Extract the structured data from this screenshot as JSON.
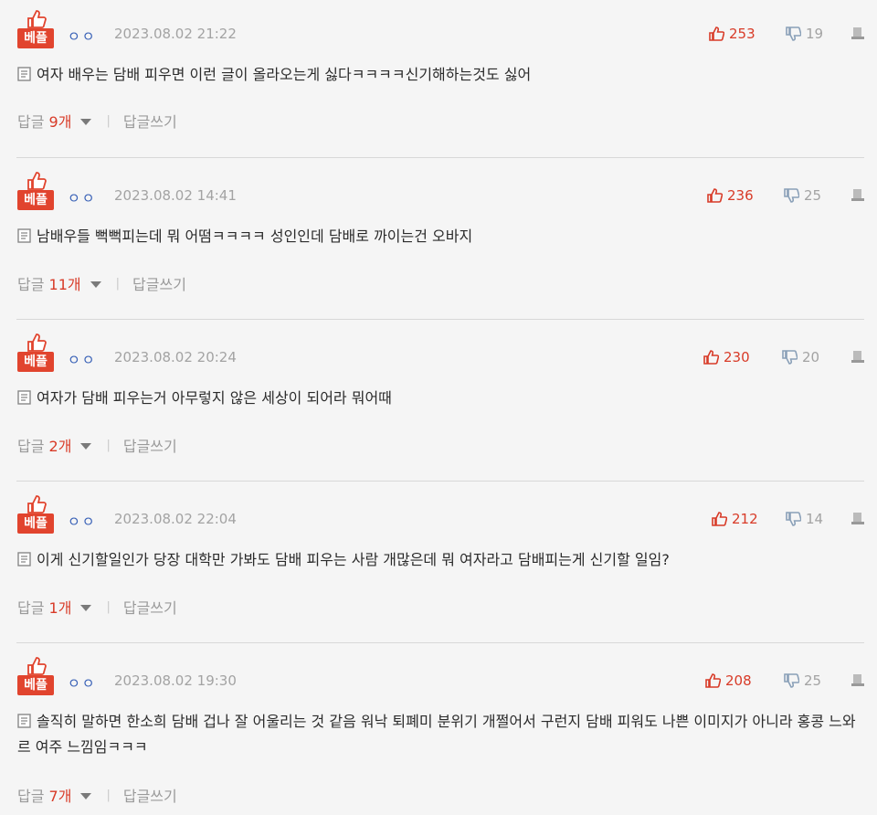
{
  "badge_label": "베플",
  "icons": {
    "best": "thumbs-up-icon",
    "upvote": "thumbs-up-icon",
    "downvote": "thumbs-down-icon",
    "report": "report-icon",
    "text": "document-icon"
  },
  "colors": {
    "accent": "#e1442e",
    "upvote": "#d83b28",
    "nickname": "#3a62b7",
    "muted": "#a3a3a3"
  },
  "comments": [
    {
      "nickname": "ㅇㅇ",
      "date": "2023.08.02 21:22",
      "up": "253",
      "down": "19",
      "text": "여자 배우는 담배 피우면 이런 글이 올라오는게 싫다ㅋㅋㅋㅋ신기해하는것도 싫어",
      "reply_label": "답글",
      "reply_count": "9개",
      "write_reply": "답글쓰기"
    },
    {
      "nickname": "ㅇㅇ",
      "date": "2023.08.02 14:41",
      "up": "236",
      "down": "25",
      "text": "남배우들 뻑뻑피는데 뭐 어떰ㅋㅋㅋㅋ 성인인데 담배로 까이는건 오바지",
      "reply_label": "답글",
      "reply_count": "11개",
      "write_reply": "답글쓰기"
    },
    {
      "nickname": "ㅇㅇ",
      "date": "2023.08.02 20:24",
      "up": "230",
      "down": "20",
      "text": "여자가 담배 피우는거 아무렇지 않은 세상이 되어라 뭐어때",
      "reply_label": "답글",
      "reply_count": "2개",
      "write_reply": "답글쓰기"
    },
    {
      "nickname": "ㅇㅇ",
      "date": "2023.08.02 22:04",
      "up": "212",
      "down": "14",
      "text": "이게 신기할일인가 당장 대학만 가봐도 담배 피우는 사람 개많은데 뭐 여자라고 담배피는게 신기할 일임?",
      "reply_label": "답글",
      "reply_count": "1개",
      "write_reply": "답글쓰기"
    },
    {
      "nickname": "ㅇㅇ",
      "date": "2023.08.02 19:30",
      "up": "208",
      "down": "25",
      "text": "솔직히 말하면 한소희 담배 겁나 잘 어울리는 것 같음 워낙 퇴폐미 분위기 개쩔어서 구런지 담배 피워도 나쁜 이미지가 아니라 홍콩 느와르 여주 느낌임ㅋㅋㅋ",
      "reply_label": "답글",
      "reply_count": "7개",
      "write_reply": "답글쓰기"
    }
  ]
}
